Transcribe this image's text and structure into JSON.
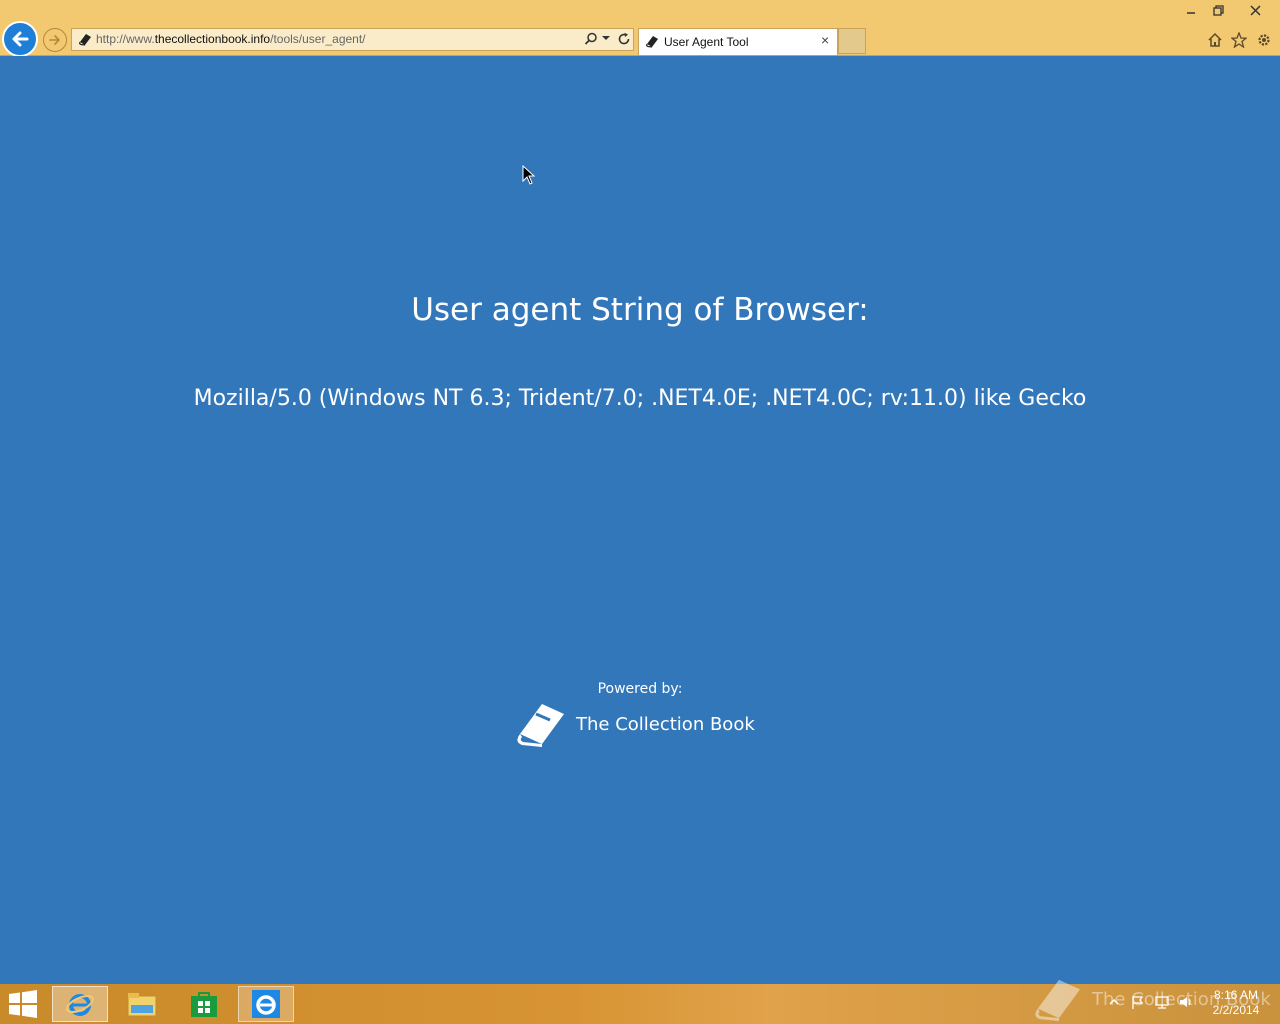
{
  "browser": {
    "address": {
      "prefix": "http://www.",
      "domain": "thecollectionbook.info",
      "path": "/tools/user_agent/"
    },
    "tab": {
      "label": "User Agent Tool",
      "close_glyph": "×"
    },
    "icons": [
      "back-arrow-icon",
      "forward-arrow-icon",
      "search-icon",
      "refresh-icon",
      "home-icon",
      "star-icon",
      "gear-icon"
    ],
    "colors": {
      "chrome": "#f2c870",
      "back_button": "#1f7ed6"
    }
  },
  "page": {
    "heading": "User agent String of Browser:",
    "user_agent": "Mozilla/5.0 (Windows NT 6.3; Trident/7.0; .NET4.0E; .NET4.0C; rv:11.0) like Gecko",
    "powered_by_label": "Powered by:",
    "brand_name": "The Collection Book",
    "background": "#3377bb"
  },
  "taskbar": {
    "watermark_text": "The Collection Book",
    "clock": {
      "time": "8:16 AM",
      "date": "2/2/2014"
    },
    "pinned": [
      "internet-explorer",
      "file-explorer",
      "store",
      "internet-explorer"
    ]
  }
}
